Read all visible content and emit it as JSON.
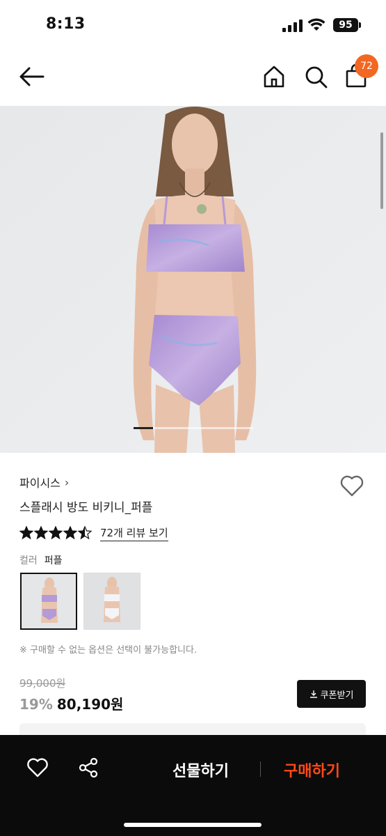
{
  "status": {
    "time": "8:13",
    "battery": "95"
  },
  "nav": {
    "cart_count": "72"
  },
  "product": {
    "brand": "파이시스",
    "name": "스플래시 방도 비키니_퍼플",
    "rating": 4.5,
    "review_link": "72개 리뷰 보기",
    "option_label": "컬러",
    "option_value": "퍼플",
    "notice": "※ 구매할 수 없는 옵션은 선택이 불가능합니다.",
    "original_price": "99,000원",
    "discount": "19%",
    "sale_price": "80,190원",
    "coupon_label": "쿠폰받기"
  },
  "bottom_bar": {
    "gift_label": "선물하기",
    "buy_label": "구매하기"
  },
  "colors": {
    "accent_orange": "#f26722",
    "buy_red": "#ff4a17",
    "bikini_purple": "#b49ad6"
  },
  "icons": [
    "back-arrow-icon",
    "home-icon",
    "search-icon",
    "shopping-bag-icon",
    "heart-icon",
    "star-icon",
    "download-icon",
    "share-icon"
  ]
}
